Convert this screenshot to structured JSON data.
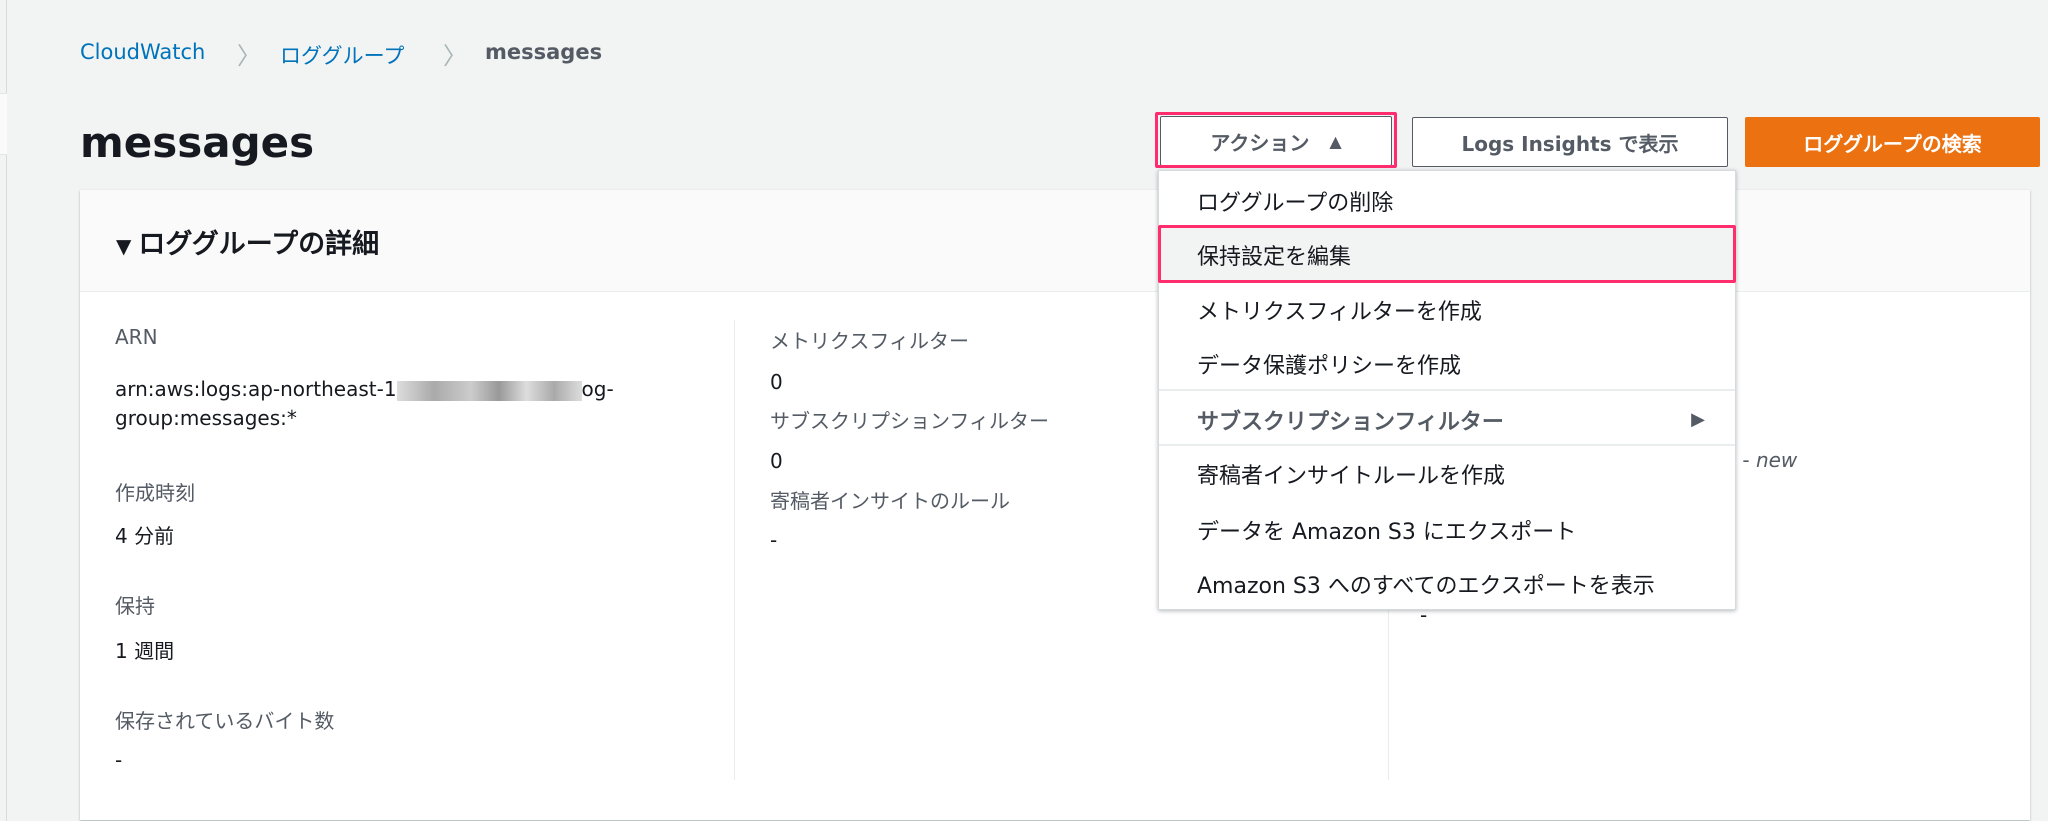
{
  "breadcrumb": {
    "items": [
      "CloudWatch",
      "ロググループ",
      "messages"
    ]
  },
  "page_title": "messages",
  "actions": {
    "actions_label": "アクション",
    "actions_icon": "caret-up-icon",
    "logs_insights_label": "Logs Insights で表示",
    "search_label": "ロググループの検索"
  },
  "menu": {
    "items": [
      {
        "label": "ロググループの削除"
      },
      {
        "label": "保持設定を編集"
      },
      {
        "label": "メトリクスフィルターを作成"
      },
      {
        "label": "データ保護ポリシーを作成"
      },
      {
        "label": "サブスクリプションフィルター"
      },
      {
        "label": "寄稿者インサイトルールを作成"
      },
      {
        "label": "データを Amazon S3 にエクスポート"
      },
      {
        "label": "Amazon S3 へのすべてのエクスポートを表示"
      }
    ]
  },
  "details": {
    "title": "ロググループの詳細",
    "arn_label": "ARN",
    "arn_prefix": "arn:aws:logs:ap-northeast-1",
    "arn_suffix": "og-",
    "arn_line2": "group:messages:*",
    "created_label": "作成時刻",
    "created_value": "4 分前",
    "retention_label": "保持",
    "retention_value": "1 週間",
    "stored_label": "保存されているバイト数",
    "stored_value": "-",
    "metric_label": "メトリクスフィルター",
    "metric_value": "0",
    "subscription_label": "サブスクリプションフィルター",
    "subscription_value": "0",
    "contributor_label": "寄稿者インサイトのルール",
    "contributor_value": "-",
    "col3_partial_prefix": "に - ",
    "col3_partial_new": "new",
    "col3_value": "-"
  },
  "colors": {
    "accent": "#ec7211",
    "link": "#0073bb",
    "highlight": "#ff2d6e"
  }
}
